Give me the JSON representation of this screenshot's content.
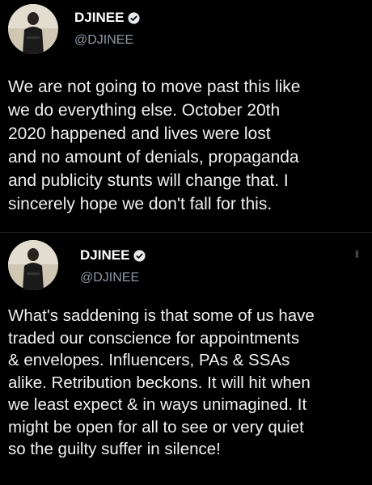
{
  "tweets": [
    {
      "display_name": "DJINEE",
      "handle": "@DJINEE",
      "text": "We are not going to move past this like\nwe do everything else. October 20th\n2020 happened and lives were lost\nand no amount of denials, propaganda\nand publicity stunts will change that. I\nsincerely hope we don't fall for this."
    },
    {
      "display_name": "DJINEE",
      "handle": "@DJINEE",
      "text": "What's saddening is that some of us have\ntraded our conscience for appointments\n& envelopes. Influencers, PAs & SSAs\nalike. Retribution beckons. It will hit when\nwe least expect & in ways unimagined. It\nmight be open for all to see or very quiet\nso the guilty suffer in silence!"
    }
  ],
  "colors": {
    "background": "#000000",
    "text": "#f0f0f0",
    "handle": "#8b98a5",
    "verified_badge": "#e7e9ea"
  },
  "icons": {
    "verified": "verified-badge-icon",
    "more": "more-options-icon"
  }
}
